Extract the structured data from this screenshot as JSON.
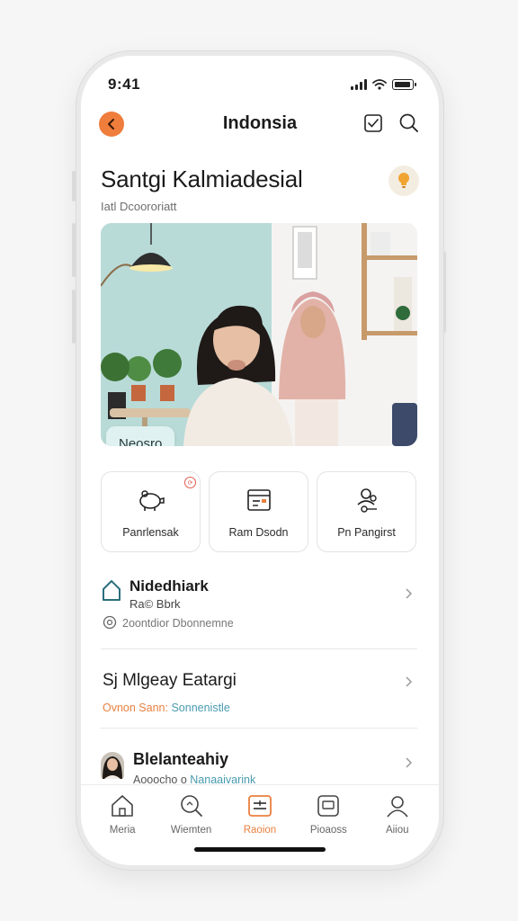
{
  "status_bar": {
    "time": "9:41"
  },
  "nav": {
    "title": "Indonsia"
  },
  "header": {
    "title": "Santgi Kalmiadesial",
    "subtitle": "Iatl Dcoororiatt"
  },
  "hero": {
    "badge": "Neosro"
  },
  "quick_actions": [
    {
      "label": "Panrlensak",
      "icon": "piggy-icon"
    },
    {
      "label": "Ram Dsodn",
      "icon": "calendar-icon"
    },
    {
      "label": "Pn Pangirst",
      "icon": "person-pin-icon"
    }
  ],
  "list": {
    "item1": {
      "title": "Nidedhiark",
      "subtitle": "Ra© Bbrk",
      "meta": "2oontdior Dbonnemne"
    },
    "item2": {
      "title": "Sj Mlgeay Eatargi",
      "meta_orange": "Ovnon Sann:",
      "meta_blue": "Sonnenistle"
    },
    "item3": {
      "title": "Blelanteahiy",
      "meta_dark": "Aooocho o",
      "meta_blue": "Nanaaivarink"
    }
  },
  "tabs": [
    {
      "label": "Meria",
      "icon": "home-icon"
    },
    {
      "label": "Wiemten",
      "icon": "search-icon"
    },
    {
      "label": "Raoion",
      "icon": "cards-icon"
    },
    {
      "label": "Pioaoss",
      "icon": "photo-icon"
    },
    {
      "label": "Aiiou",
      "icon": "profile-icon"
    }
  ],
  "colors": {
    "accent": "#ef7d3c",
    "teal": "#4a9bb0",
    "badge_bg": "#dff1f1"
  }
}
